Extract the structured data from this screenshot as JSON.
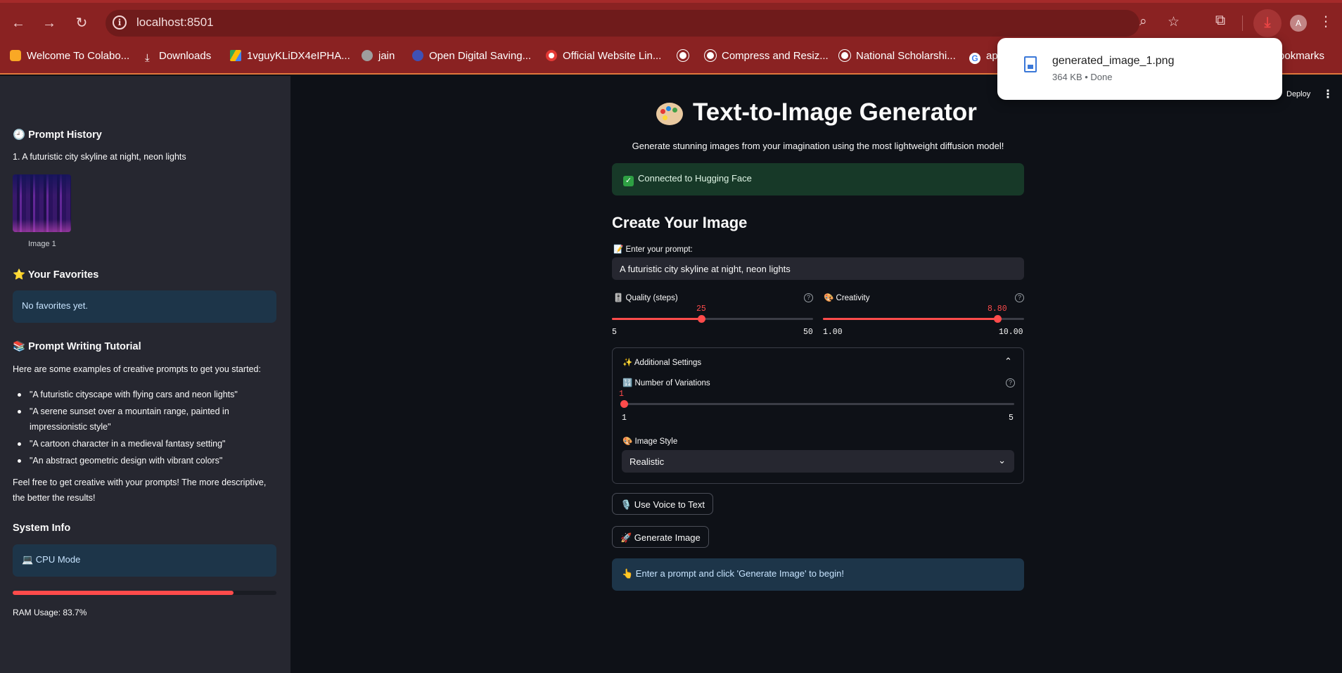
{
  "browser": {
    "url": "localhost:8501",
    "bookmarks": [
      {
        "label": "Welcome To Colabo...",
        "icon": "colab-icon"
      },
      {
        "label": "Downloads",
        "icon": "download-icon"
      },
      {
        "label": "1vguyKLiDX4eIPHA...",
        "icon": "google-drive-icon"
      },
      {
        "label": "jain",
        "icon": "site-icon"
      },
      {
        "label": "Open Digital Saving...",
        "icon": "bank-icon"
      },
      {
        "label": "Official Website Lin...",
        "icon": "site-icon"
      },
      {
        "label": "",
        "icon": "globe-icon"
      },
      {
        "label": "Compress and Resiz...",
        "icon": "globe-icon"
      },
      {
        "label": "National Scholarshi...",
        "icon": "globe-icon"
      },
      {
        "label": "ap",
        "icon": "google-icon"
      }
    ],
    "all_bookmarks": "Bookmarks",
    "download": {
      "filename": "generated_image_1.png",
      "meta": "364 KB • Done"
    },
    "avatar_letter": "A"
  },
  "sidebar": {
    "prompt_history_title": "🕘 Prompt History",
    "history_items": [
      {
        "label": "1. A futuristic city skyline at night, neon lights",
        "caption": "Image 1"
      }
    ],
    "favorites_title": "⭐ Your Favorites",
    "favorites_empty": "No favorites yet.",
    "tutorial_title": "📚 Prompt Writing Tutorial",
    "tutorial_intro": "Here are some examples of creative prompts to get you started:",
    "tutorial_examples": [
      "\"A futuristic cityscape with flying cars and neon lights\"",
      "\"A serene sunset over a mountain range, painted in impressionistic style\"",
      "\"A cartoon character in a medieval fantasy setting\"",
      "\"An abstract geometric design with vibrant colors\""
    ],
    "tutorial_outro": "Feel free to get creative with your prompts! The more descriptive, the better the results!",
    "system_info_title": "System Info",
    "cpu_mode": "💻 CPU Mode",
    "ram_usage_fraction": 0.837,
    "ram_usage_label": "RAM Usage: 83.7%"
  },
  "header": {
    "deploy": "Deploy"
  },
  "main": {
    "title": "Text-to-Image Generator",
    "subtitle": "Generate stunning images from your imagination using the most lightweight diffusion model!",
    "status": "Connected to Hugging Face",
    "section_title": "Create Your Image",
    "prompt_label": "📝 Enter your prompt:",
    "prompt_value": "A futuristic city skyline at night, neon lights",
    "quality": {
      "label": "🎚️ Quality (steps)",
      "value": "25",
      "min": "5",
      "max": "50"
    },
    "creativity": {
      "label": "🎨 Creativity",
      "value": "8.80",
      "min": "1.00",
      "max": "10.00"
    },
    "additional_settings": "✨ Additional Settings",
    "variations": {
      "label": "🔢 Number of Variations",
      "value": "1",
      "min": "1",
      "max": "5"
    },
    "image_style_label": "🎨 Image Style",
    "image_style_value": "Realistic",
    "voice_button": "🎙️ Use Voice to Text",
    "generate_button": "🚀 Generate Image",
    "hint": "👆 Enter a prompt and click 'Generate Image' to begin!"
  },
  "colors": {
    "accent": "#ff4b4b",
    "chrome": "#8a2222",
    "sidebar_bg": "#262730",
    "main_bg": "#0e1117"
  }
}
